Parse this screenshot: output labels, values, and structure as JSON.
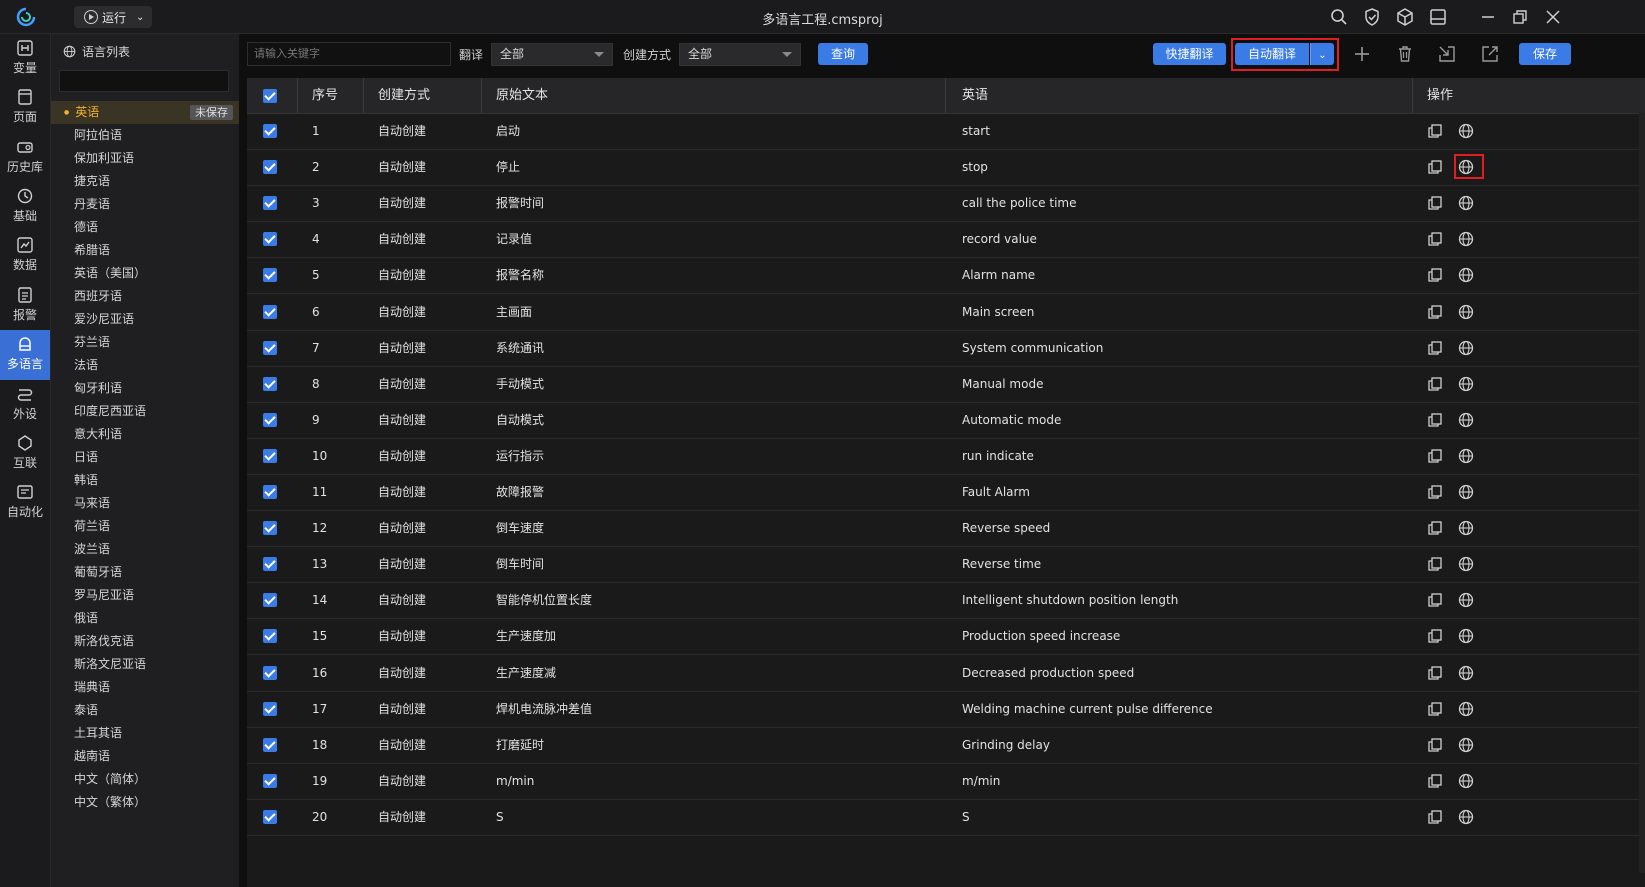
{
  "titlebar": {
    "run_label": "运行",
    "window_title": "多语言工程.cmsproj"
  },
  "nav": [
    {
      "label": "变量",
      "icon": "variable-icon"
    },
    {
      "label": "页面",
      "icon": "page-icon"
    },
    {
      "label": "历史库",
      "icon": "history-icon"
    },
    {
      "label": "基础",
      "icon": "basic-icon"
    },
    {
      "label": "数据",
      "icon": "data-icon"
    },
    {
      "label": "报警",
      "icon": "alarm-icon"
    },
    {
      "label": "多语言",
      "icon": "multilang-icon",
      "active": true
    },
    {
      "label": "外设",
      "icon": "peripheral-icon"
    },
    {
      "label": "互联",
      "icon": "interconnect-icon"
    },
    {
      "label": "自动化",
      "icon": "automation-icon"
    }
  ],
  "language_panel": {
    "title": "语言列表",
    "unsaved_badge": "未保存",
    "languages": [
      "英语",
      "阿拉伯语",
      "保加利亚语",
      "捷克语",
      "丹麦语",
      "德语",
      "希腊语",
      "英语（美国）",
      "西班牙语",
      "爱沙尼亚语",
      "芬兰语",
      "法语",
      "匈牙利语",
      "印度尼西亚语",
      "意大利语",
      "日语",
      "韩语",
      "马来语",
      "荷兰语",
      "波兰语",
      "葡萄牙语",
      "罗马尼亚语",
      "俄语",
      "斯洛伐克语",
      "斯洛文尼亚语",
      "瑞典语",
      "泰语",
      "土耳其语",
      "越南语",
      "中文（简体）",
      "中文（繁体）"
    ]
  },
  "toolbar": {
    "keyword_placeholder": "请输入关键字",
    "translate_label": "翻译",
    "translate_value": "全部",
    "create_label": "创建方式",
    "create_value": "全部",
    "query_label": "查询",
    "quick_translate_label": "快捷翻译",
    "auto_translate_label": "自动翻译",
    "save_label": "保存"
  },
  "table": {
    "headers": {
      "index": "序号",
      "method": "创建方式",
      "source": "原始文本",
      "english": "英语",
      "ops": "操作"
    },
    "rows": [
      {
        "index": "1",
        "method": "自动创建",
        "source": "启动",
        "english": "start"
      },
      {
        "index": "2",
        "method": "自动创建",
        "source": "停止",
        "english": "stop"
      },
      {
        "index": "3",
        "method": "自动创建",
        "source": "报警时间",
        "english": "call the police time"
      },
      {
        "index": "4",
        "method": "自动创建",
        "source": "记录值",
        "english": "record value"
      },
      {
        "index": "5",
        "method": "自动创建",
        "source": "报警名称",
        "english": "Alarm name"
      },
      {
        "index": "6",
        "method": "自动创建",
        "source": "主画面",
        "english": "Main screen"
      },
      {
        "index": "7",
        "method": "自动创建",
        "source": "系统通讯",
        "english": "System communication"
      },
      {
        "index": "8",
        "method": "自动创建",
        "source": "手动模式",
        "english": "Manual mode"
      },
      {
        "index": "9",
        "method": "自动创建",
        "source": "自动模式",
        "english": "Automatic mode"
      },
      {
        "index": "10",
        "method": "自动创建",
        "source": "运行指示",
        "english": "run indicate"
      },
      {
        "index": "11",
        "method": "自动创建",
        "source": "故障报警",
        "english": "Fault Alarm"
      },
      {
        "index": "12",
        "method": "自动创建",
        "source": "倒车速度",
        "english": "Reverse speed"
      },
      {
        "index": "13",
        "method": "自动创建",
        "source": "倒车时间",
        "english": "Reverse time"
      },
      {
        "index": "14",
        "method": "自动创建",
        "source": "智能停机位置长度",
        "english": "Intelligent shutdown position length"
      },
      {
        "index": "15",
        "method": "自动创建",
        "source": "生产速度加",
        "english": "Production speed increase"
      },
      {
        "index": "16",
        "method": "自动创建",
        "source": "生产速度减",
        "english": "Decreased production speed"
      },
      {
        "index": "17",
        "method": "自动创建",
        "source": "焊机电流脉冲差值",
        "english": "Welding machine current pulse difference"
      },
      {
        "index": "18",
        "method": "自动创建",
        "source": "打磨延时",
        "english": "Grinding delay"
      },
      {
        "index": "19",
        "method": "自动创建",
        "source": "m/min",
        "english": "m/min"
      },
      {
        "index": "20",
        "method": "自动创建",
        "source": "S",
        "english": "S"
      }
    ]
  },
  "colors": {
    "accent": "#3b7be6",
    "highlight": "#e02020",
    "active_language": "#f0b030"
  }
}
